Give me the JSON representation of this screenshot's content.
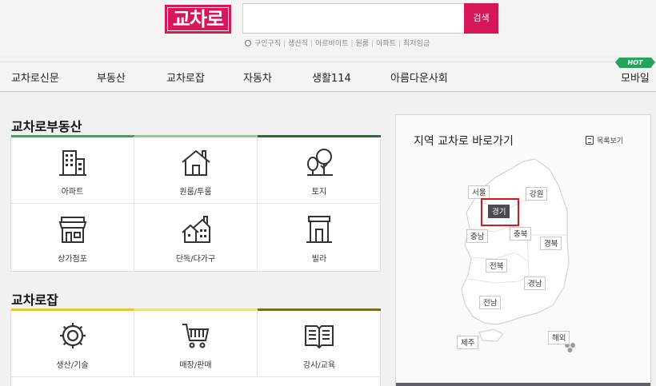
{
  "header": {
    "logo_text": "교차로",
    "search_placeholder": "",
    "search_button": "검색",
    "keywords": [
      "구인구직",
      "생산직",
      "아르바이트",
      "원룸",
      "아파트",
      "최저임금"
    ]
  },
  "nav": {
    "items": [
      "교차로신문",
      "부동산",
      "교차로잡",
      "자동차",
      "생활114",
      "아름다운사회",
      "모바일"
    ],
    "hot_badge": "HOT"
  },
  "realestate": {
    "title": "교차로부동산",
    "items": [
      "아파트",
      "원룸/투룸",
      "토지",
      "상가점포",
      "단독/다가구",
      "빌라"
    ]
  },
  "jobs": {
    "title": "교차로잡",
    "items": [
      "생산/기술",
      "매장/판매",
      "강사/교육"
    ]
  },
  "region": {
    "title": "지역 교차로 바로가기",
    "list_link": "목록보기",
    "labels": [
      "서울",
      "강원",
      "경기",
      "충남",
      "충북",
      "경북",
      "전북",
      "경남",
      "전남",
      "제주",
      "해외"
    ],
    "selected": "경기"
  },
  "colors": {
    "brand": "#d8175a",
    "realestate_bar": "#3aa757",
    "jobs_bar": "#e5c93a",
    "hot": "#23a35c",
    "highlight": "#d11b1b"
  }
}
